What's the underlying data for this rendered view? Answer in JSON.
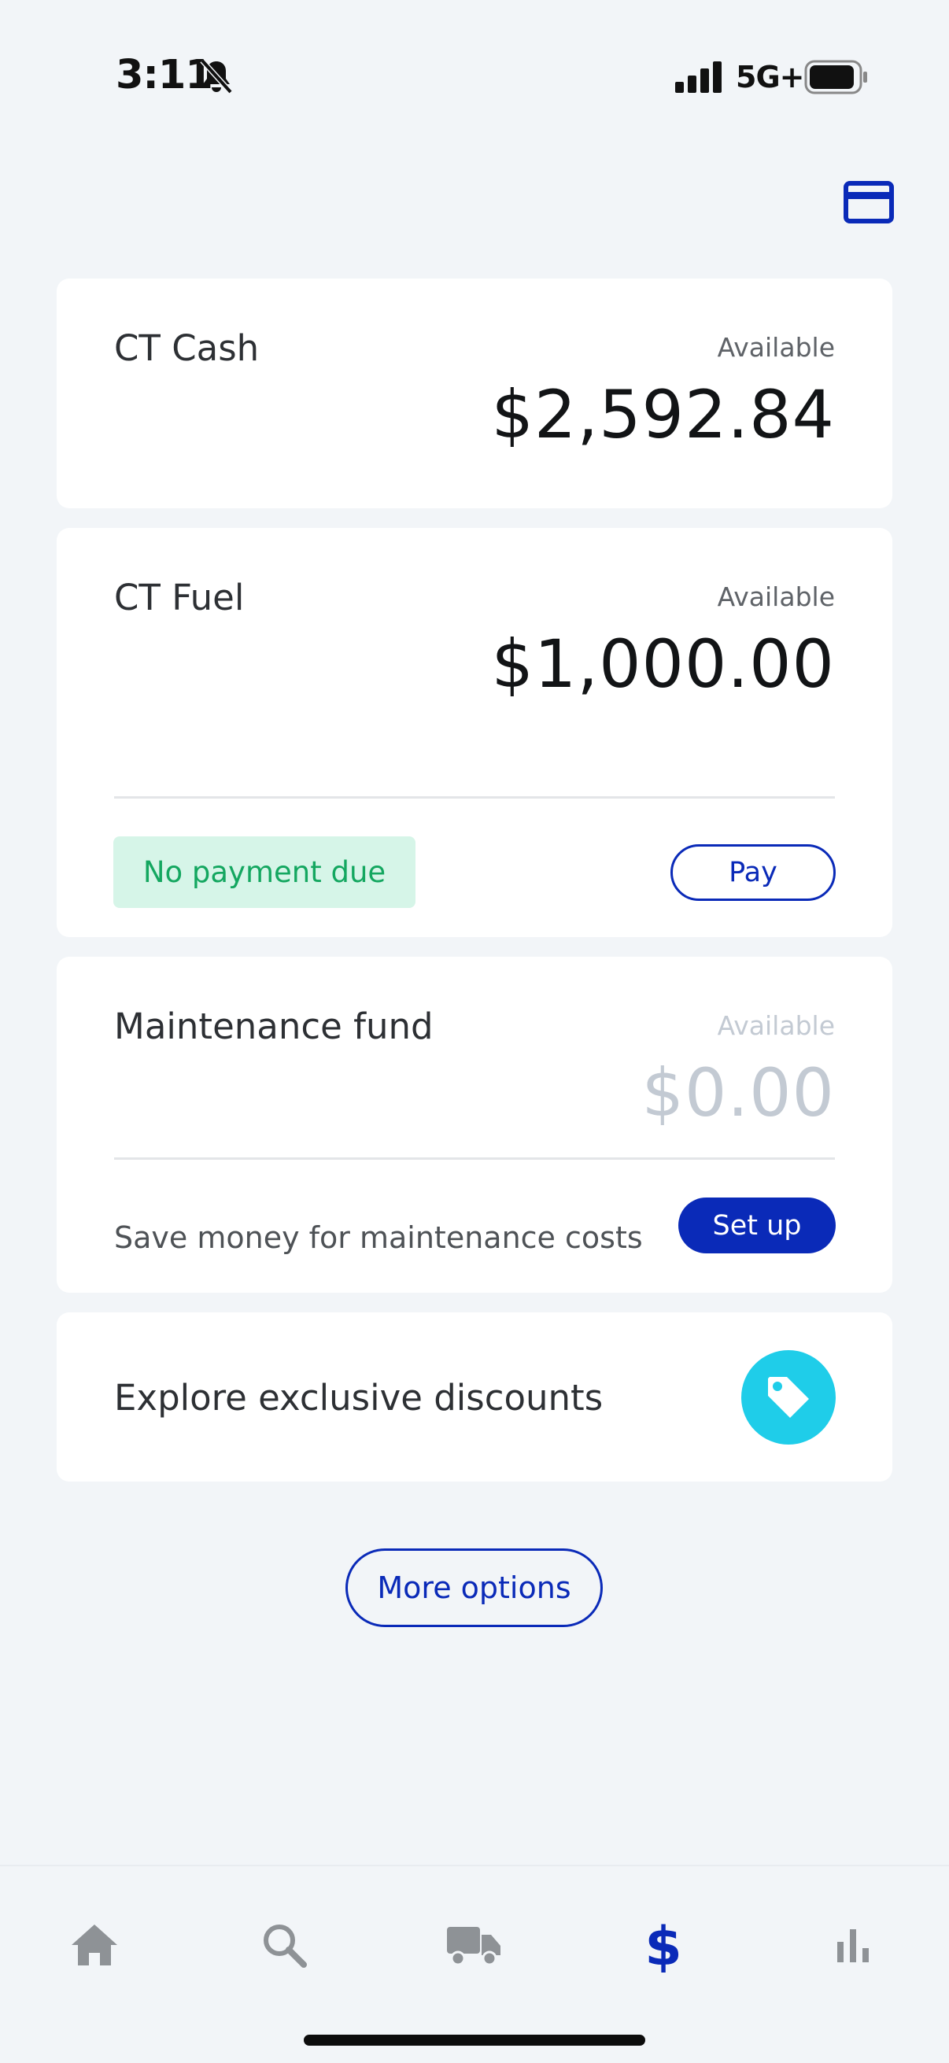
{
  "status_bar": {
    "time": "3:11",
    "network": "5G+"
  },
  "cards": {
    "ct_cash": {
      "title": "CT Cash",
      "available_label": "Available",
      "amount": "$2,592.84"
    },
    "ct_fuel": {
      "title": "CT Fuel",
      "available_label": "Available",
      "amount": "$1,000.00",
      "status_badge": "No payment due",
      "pay_label": "Pay"
    },
    "maintenance": {
      "title": "Maintenance fund",
      "available_label": "Available",
      "amount": "$0.00",
      "description": "Save money for maintenance costs",
      "setup_label": "Set up"
    },
    "discounts": {
      "title": "Explore exclusive discounts"
    }
  },
  "more_options_label": "More options",
  "tabbar": {
    "items": [
      {
        "icon": "home-icon",
        "active": false
      },
      {
        "icon": "search-icon",
        "active": false
      },
      {
        "icon": "truck-icon",
        "active": false
      },
      {
        "icon": "dollar-icon",
        "active": true
      },
      {
        "icon": "bar-chart-icon",
        "active": false
      }
    ]
  },
  "colors": {
    "accent": "#0a2ab8",
    "success_text": "#14a760",
    "success_bg": "#d6f5e8",
    "tag": "#1fcde9",
    "background": "#f2f5f8",
    "inactive_icon": "#8e9296"
  }
}
